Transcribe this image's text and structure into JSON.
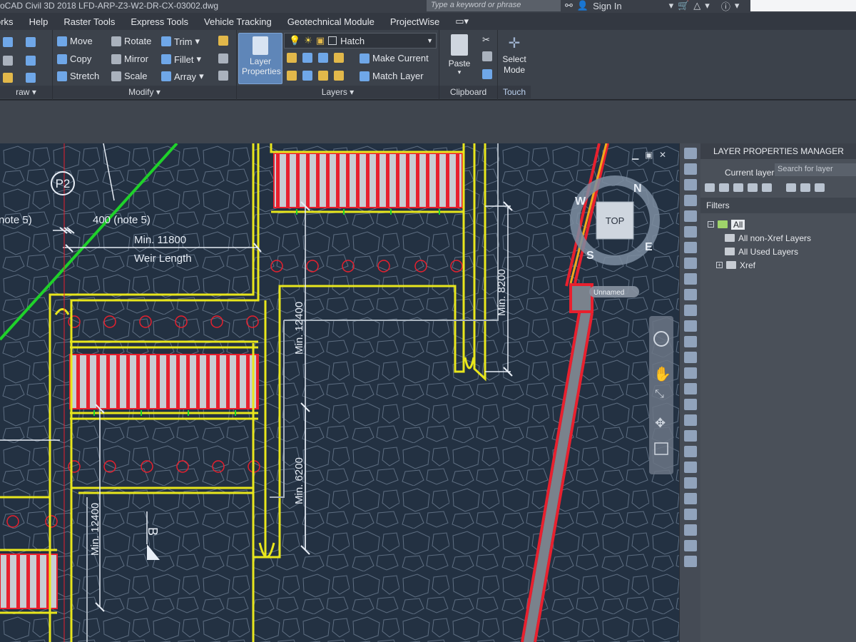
{
  "titlebar": {
    "title": "oCAD Civil 3D 2018    LFD-ARP-Z3-W2-DR-CX-03002.dwg",
    "search_placeholder": "Type a keyword or phrase",
    "sign_in": "Sign In"
  },
  "menu": [
    "orks",
    "Help",
    "Raster Tools",
    "Express Tools",
    "Vehicle Tracking",
    "Geotechnical Module",
    "ProjectWise"
  ],
  "ribbon": {
    "draw_panel": {
      "title": "raw"
    },
    "modify_panel": {
      "title": "Modify",
      "buttons": [
        "Move",
        "Rotate",
        "Trim",
        "Copy",
        "Mirror",
        "Fillet",
        "Stretch",
        "Scale",
        "Array"
      ]
    },
    "layers_panel": {
      "title": "Layers",
      "layer_properties": "Layer Properties",
      "current_layer": "Hatch",
      "make_current": "Make Current",
      "match_layer": "Match Layer"
    },
    "clipboard_panel": {
      "title": "Clipboard",
      "paste": "Paste"
    },
    "touch_panel": {
      "title": "Touch",
      "select_mode": "Select Mode"
    }
  },
  "drawing": {
    "annotations": {
      "p2": "P2",
      "note5_left": "note 5)",
      "note5_mid": "400 (note 5)",
      "min_11800": "Min. 11800",
      "weir_length": "Weir Length",
      "min_12400_a": "Min. 12400",
      "min_8200": "Min. 8200",
      "min_6200": "Min. 6200",
      "min_12400_b": "Min. 12400",
      "section_b": "B"
    },
    "viewcube": {
      "top": "TOP",
      "n": "N",
      "e": "E",
      "s": "S",
      "w": "W",
      "ucs": "Unnamed"
    }
  },
  "layer_manager": {
    "title": "LAYER PROPERTIES MANAGER",
    "current_layer_label": "Current layer",
    "search_placeholder": "Search for layer",
    "filters_label": "Filters",
    "tree": [
      "All",
      "All non-Xref Layers",
      "All Used Layers",
      "Xref"
    ]
  },
  "colors": {
    "background": "#233142",
    "yellow": "#e8e61c",
    "red": "#e8202e",
    "green": "#1fd12a",
    "white": "#e8eef6"
  }
}
